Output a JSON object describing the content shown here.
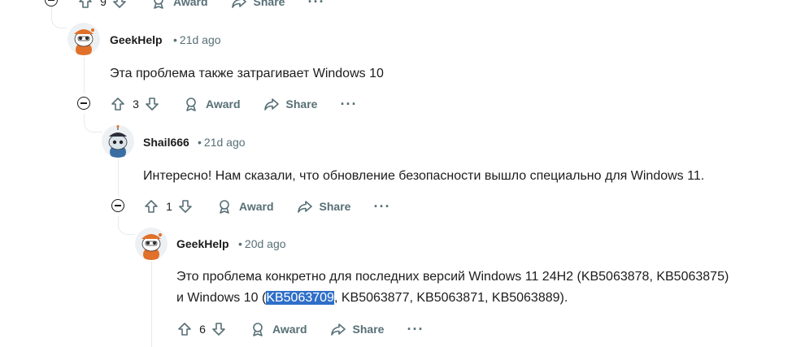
{
  "top_actions": {
    "vote_count": "9",
    "award_label": "Award",
    "share_label": "Share",
    "more_label": "···"
  },
  "comments": [
    {
      "author": "GeekHelp",
      "time": "21d ago",
      "text_lines": [
        "Эта проблема также затрагивает Windows 10"
      ],
      "vote_count": "3",
      "award_label": "Award",
      "share_label": "Share",
      "more_label": "···"
    },
    {
      "author": "Shail666",
      "time": "21d ago",
      "text_lines": [
        "Интересно! Нам сказали, что обновление безопасности вышло специально для Windows 11."
      ],
      "vote_count": "1",
      "award_label": "Award",
      "share_label": "Share",
      "more_label": "···"
    },
    {
      "author": "GeekHelp",
      "time": "20d ago",
      "text_line1": "Это проблема конкретно для последних версий Windows 11 24H2 (KB5063878, KB5063875)",
      "text_line2_before": "и Windows 10 (",
      "text_line2_selected": "KB5063709",
      "text_line2_after": ", KB5063877, KB5063871, KB5063889).",
      "vote_count": "6",
      "award_label": "Award",
      "share_label": "Share",
      "more_label": "···"
    }
  ],
  "meta_separator": "•"
}
